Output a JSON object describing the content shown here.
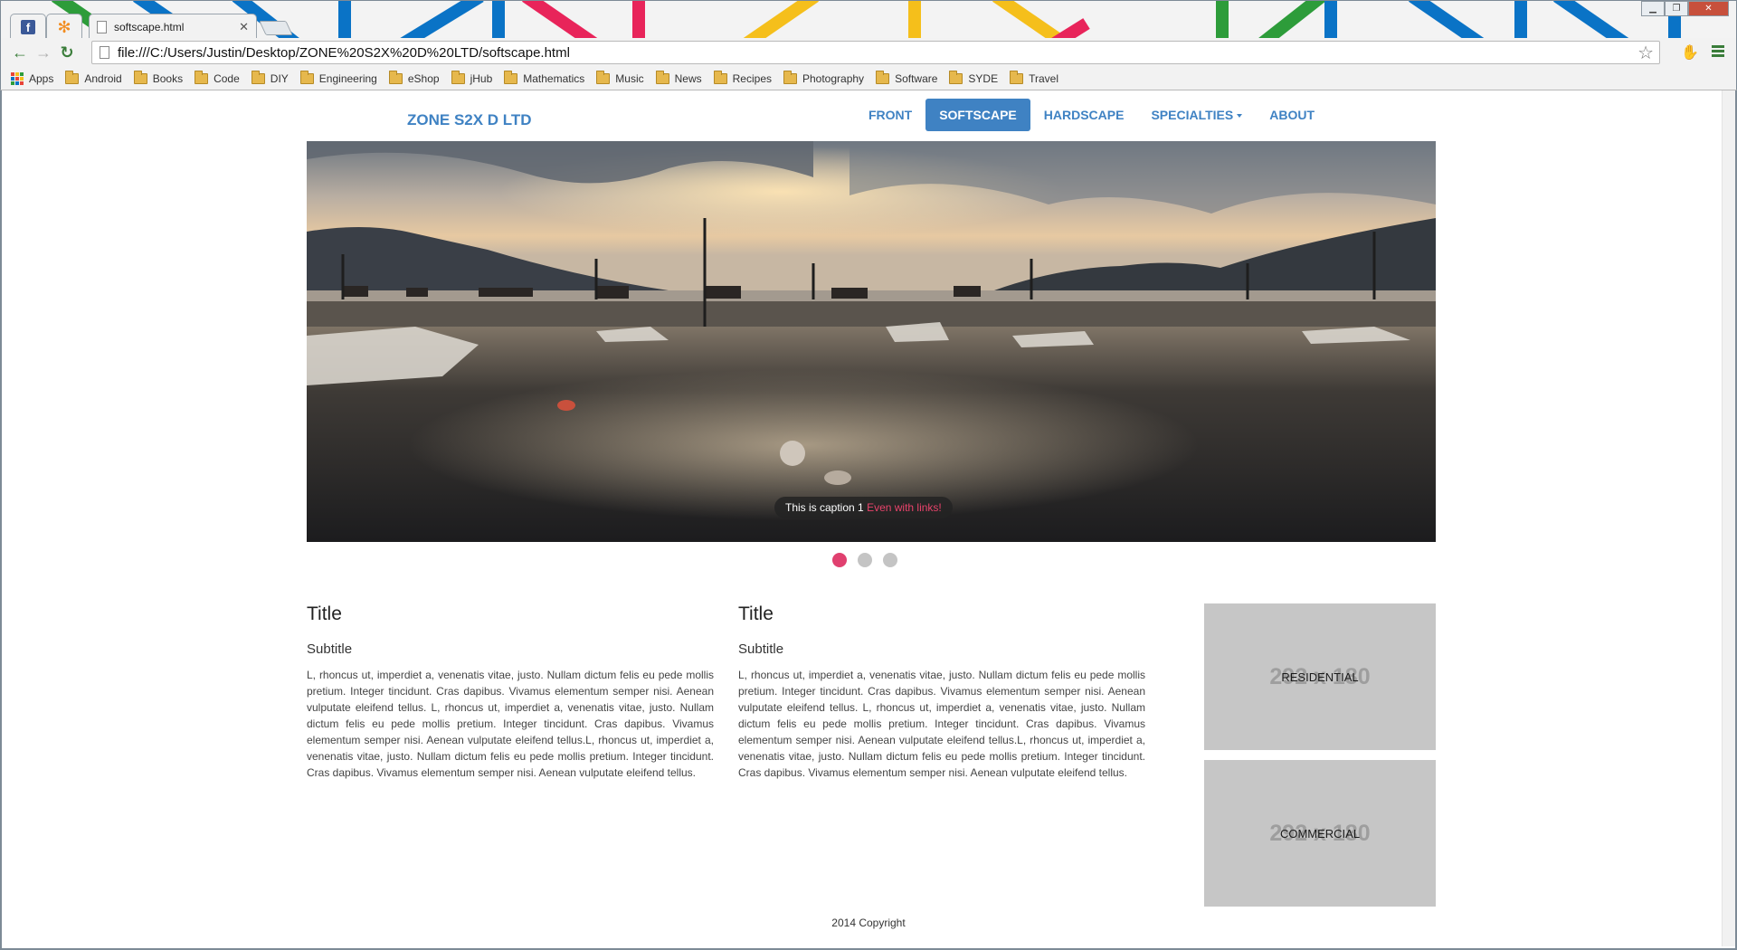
{
  "browser": {
    "tabs": {
      "pinned_1_icon": "facebook-icon",
      "pinned_2_icon": "flower-icon",
      "active_title": "softscape.html"
    },
    "url": "file:///C:/Users/Justin/Desktop/ZONE%20S2X%20D%20LTD/softscape.html",
    "bookmarks": [
      "Apps",
      "Android",
      "Books",
      "Code",
      "DIY",
      "Engineering",
      "eShop",
      "jHub",
      "Mathematics",
      "Music",
      "News",
      "Recipes",
      "Photography",
      "Software",
      "SYDE",
      "Travel"
    ]
  },
  "site": {
    "brand": "ZONE S2X D LTD",
    "nav": [
      "FRONT",
      "SOFTSCAPE",
      "HARDSCAPE",
      "SPECIALTIES",
      "ABOUT"
    ],
    "active_nav": "SOFTSCAPE"
  },
  "carousel": {
    "caption_text": "This is caption 1",
    "caption_link": "Even with links!",
    "slide_count": 3,
    "active_slide": 1
  },
  "columns": [
    {
      "title": "Title",
      "subtitle": "Subtitle",
      "body": "L, rhoncus ut, imperdiet a, venenatis vitae, justo. Nullam dictum felis eu pede mollis pretium. Integer tincidunt. Cras dapibus. Vivamus elementum semper nisi. Aenean vulputate eleifend tellus. L, rhoncus ut, imperdiet a, venenatis vitae, justo. Nullam dictum felis eu pede mollis pretium. Integer tincidunt. Cras dapibus. Vivamus elementum semper nisi. Aenean vulputate eleifend tellus.L, rhoncus ut, imperdiet a, venenatis vitae, justo. Nullam dictum felis eu pede mollis pretium. Integer tincidunt. Cras dapibus. Vivamus elementum semper nisi. Aenean vulputate eleifend tellus."
    },
    {
      "title": "Title",
      "subtitle": "Subtitle",
      "body": "L, rhoncus ut, imperdiet a, venenatis vitae, justo. Nullam dictum felis eu pede mollis pretium. Integer tincidunt. Cras dapibus. Vivamus elementum semper nisi. Aenean vulputate eleifend tellus. L, rhoncus ut, imperdiet a, venenatis vitae, justo. Nullam dictum felis eu pede mollis pretium. Integer tincidunt. Cras dapibus. Vivamus elementum semper nisi. Aenean vulputate eleifend tellus.L, rhoncus ut, imperdiet a, venenatis vitae, justo. Nullam dictum felis eu pede mollis pretium. Integer tincidunt. Cras dapibus. Vivamus elementum semper nisi. Aenean vulputate eleifend tellus."
    }
  ],
  "side_cards": [
    {
      "placeholder": "292 x 180",
      "label": "RESIDENTIAL"
    },
    {
      "placeholder": "292 x 180",
      "label": "COMMERCIAL"
    }
  ],
  "footer": "2014 Copyright",
  "colors": {
    "brand_blue": "#3f82c3",
    "caption_link": "#e8436b",
    "active_dot": "#e0406f",
    "card_bg": "#c6c6c6"
  }
}
